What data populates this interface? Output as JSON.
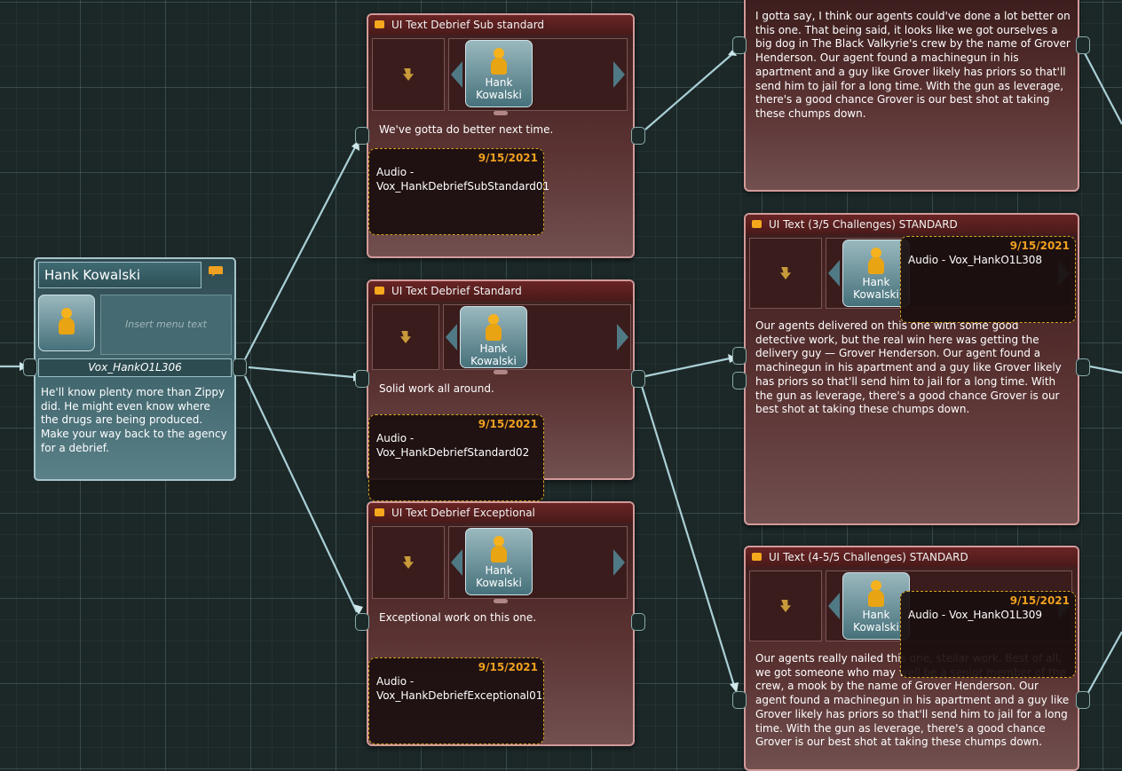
{
  "hank_node": {
    "name": "Hank Kowalski",
    "menu_placeholder": "Insert menu text",
    "audio_label": "Vox_HankO1L306",
    "text": "He'll know plenty more than Zippy did. He might even know where the drugs are being produced. Make your way back to the agency for a debrief."
  },
  "nodes": [
    {
      "title": "UI Text Debrief Sub standard",
      "speaker_first": "Hank",
      "speaker_last": "Kowalski",
      "text": "We've gotta do better next time.",
      "date": "9/15/2021",
      "audio": "Audio - Vox_HankDebriefSubStandard01"
    },
    {
      "title": "UI Text Debrief Standard",
      "speaker_first": "Hank",
      "speaker_last": "Kowalski",
      "text": "Solid work all around.",
      "date": "9/15/2021",
      "audio": "Audio - Vox_HankDebriefStandard02"
    },
    {
      "title": "UI Text Debrief Exceptional",
      "speaker_first": "Hank",
      "speaker_last": "Kowalski",
      "text": "Exceptional work on this one.",
      "date": "9/15/2021",
      "audio": "Audio - Vox_HankDebriefExceptional01"
    },
    {
      "title": "",
      "speaker_first": "",
      "speaker_last": "",
      "text": "I gotta say, I think our agents could've done a lot better on this one. That being said, it looks like we got ourselves a big dog in The Black Valkyrie's crew by the name of Grover Henderson. Our agent found a machinegun in his apartment and a guy like Grover likely has priors so that'll send him to jail for a long time. With the gun as leverage, there's a good chance Grover is our best shot at taking these chumps down.",
      "date": "",
      "audio": ""
    },
    {
      "title": "UI Text (3/5 Challenges) STANDARD",
      "speaker_first": "Hank",
      "speaker_last": "Kowalski",
      "text": "Our agents delivered on this one with some good detective work, but the real win here was getting the delivery guy — Grover Henderson. Our agent found a machinegun in his apartment and a guy like Grover likely has priors so that'll send him to jail for a long time. With the gun as leverage, there's a good chance Grover is our best shot at taking these chumps down.",
      "date": "9/15/2021",
      "audio": "Audio - Vox_HankO1L308"
    },
    {
      "title": "UI Text (4-5/5 Challenges) STANDARD",
      "speaker_first": "Hank",
      "speaker_last": "Kowalski",
      "text": "Our agents really nailed this one, stellar work. Best of all, we got someone who may well be a senior member of the crew, a mook by the name of Grover Henderson. Our agent found a machinegun in his apartment and a guy like Grover likely has priors so that'll send him to jail for a long time. With the gun as leverage, there's a good chance Grover is our best shot at taking these chumps down.",
      "date": "9/15/2021",
      "audio": "Audio - Vox_HankO1L309"
    }
  ],
  "colors": {
    "accent": "#f0a020",
    "node_border": "#d29a9a",
    "wire": "#a9d0d6"
  }
}
